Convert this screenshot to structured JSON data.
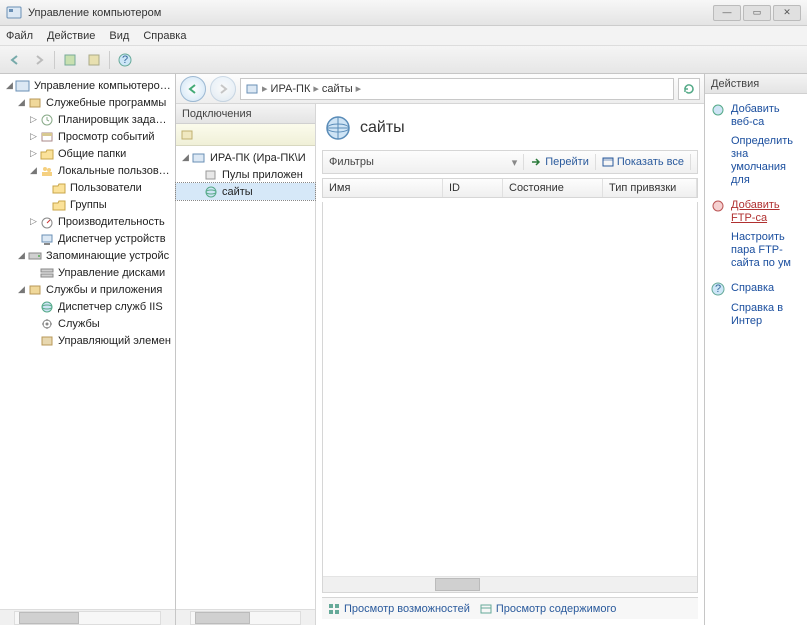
{
  "window": {
    "title": "Управление компьютером"
  },
  "menu": {
    "file": "Файл",
    "action": "Действие",
    "view": "Вид",
    "help": "Справка"
  },
  "tree": {
    "root": "Управление компьютером (л",
    "systools": "Служебные программы",
    "scheduler": "Планировщик заданий",
    "eventvwr": "Просмотр событий",
    "shared": "Общие папки",
    "localusers": "Локальные пользовате",
    "users": "Пользователи",
    "groups": "Группы",
    "perf": "Производительность",
    "devmgr": "Диспетчер устройств",
    "storage": "Запоминающие устройс",
    "diskmgr": "Управление дисками",
    "services_apps": "Службы и приложения",
    "iis": "Диспетчер служб IIS",
    "services": "Службы",
    "wmi": "Управляющий элемен"
  },
  "address": {
    "host": "ИРА-ПК",
    "node": "сайты"
  },
  "conn": {
    "header": "Подключения",
    "server": "ИРА-ПК (Ира-ПК\\И",
    "pools": "Пулы приложен",
    "sites": "сайты"
  },
  "content": {
    "title": "сайты",
    "filter_label": "Фильтры",
    "go": "Перейти",
    "showall": "Показать все",
    "cols": {
      "name": "Имя",
      "id": "ID",
      "state": "Состояние",
      "binding": "Тип привязки"
    }
  },
  "tabs": {
    "features": "Просмотр возможностей",
    "content": "Просмотр содержимого"
  },
  "actions": {
    "header": "Действия",
    "add_site": "Добавить веб-са",
    "set_defaults": "Определить зна умолчания для",
    "add_ftp": "Добавить FTP-са",
    "ftp_defaults": "Настроить пара FTP-сайта по ум",
    "help": "Справка",
    "online_help": "Справка в Интер"
  }
}
